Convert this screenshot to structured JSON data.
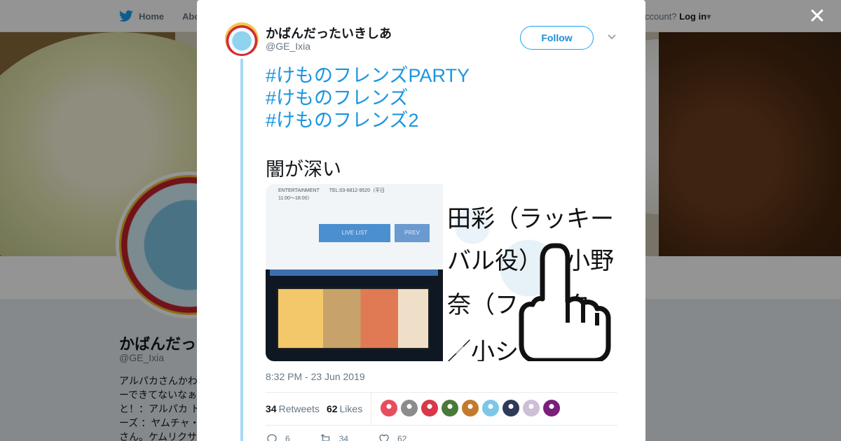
{
  "topbar": {
    "home_label": "Home",
    "about_label": "Abo",
    "account_prompt": "ccount?",
    "login_label": "Log in"
  },
  "profile": {
    "name": "かばんだっ",
    "handle": "@GE_Ixia",
    "bio": "アルパカさんかわ\nーできてないなぁ\nと！：アルパカ ト\nーズ ：ヤムチャ・\nさん。ケムリクサ"
  },
  "tweet": {
    "author_name": "かばんだったいきしあ",
    "author_handle": "@GE_Ixia",
    "follow_label": "Follow",
    "hashtags": [
      "#けものフレンズPARTY",
      "#けものフレンズ",
      "#けものフレンズ2"
    ],
    "text": "闇が深い",
    "media_left": {
      "caption": "ENTERTAINMENT　　TEL:03-6812-9520（平日\n11:00〜18:00）",
      "button1": "LIVE LIST",
      "button2": "PREV"
    },
    "media_right": {
      "lines": [
        "田彩（ラッキー",
        "バル役）／小野",
        "奈（フ　ルク",
        "／小シ　　　（"
      ]
    },
    "timestamp": "8:32 PM - 23 Jun 2019",
    "retweets_count": "34",
    "retweets_label": "Retweets",
    "likes_count": "62",
    "likes_label": "Likes",
    "likers": [
      {
        "name": "liker-1",
        "color": "#e84d5b"
      },
      {
        "name": "liker-2",
        "color": "#8c8c8c"
      },
      {
        "name": "liker-3",
        "color": "#d9384a"
      },
      {
        "name": "liker-4",
        "color": "#4a7a3a"
      },
      {
        "name": "liker-5",
        "color": "#c47a2c"
      },
      {
        "name": "liker-6",
        "color": "#7cc7e8"
      },
      {
        "name": "liker-7",
        "color": "#2f3a5a"
      },
      {
        "name": "liker-8",
        "color": "#cdbfd6"
      },
      {
        "name": "liker-9",
        "color": "#7a1f7a"
      }
    ],
    "actions": {
      "reply_count": "6",
      "retweet_count": "34",
      "like_count": "62"
    }
  },
  "colors": {
    "accent": "#1da1f2",
    "link": "#1b95e0",
    "thread_line": "#a7d8f5"
  }
}
